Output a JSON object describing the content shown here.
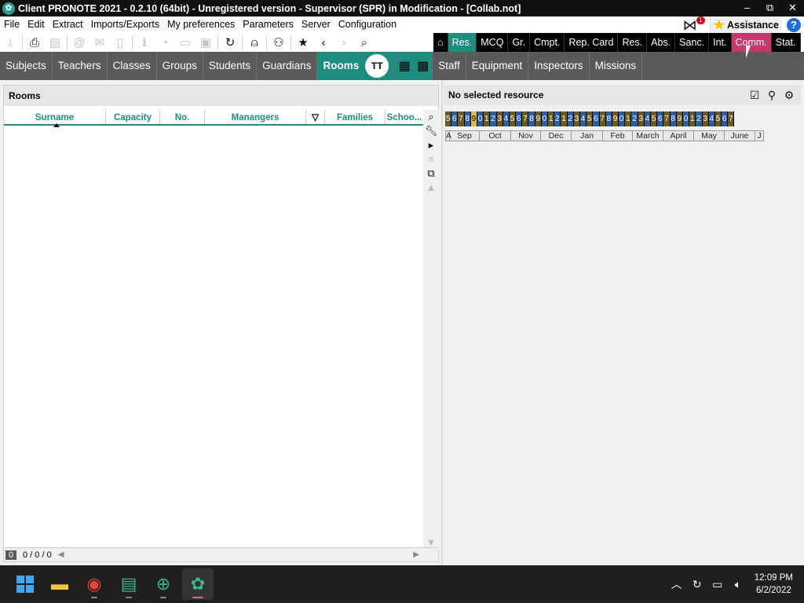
{
  "window": {
    "title": "Client PRONOTE 2021 - 0.2.10 (64bit) - Unregistered version  - Supervisor (SPR) in Modification - [Collab.not]",
    "buttons": [
      "–",
      "⧉",
      "✕"
    ]
  },
  "menu": {
    "items": [
      "File",
      "Edit",
      "Extract",
      "Imports/Exports",
      "My preferences",
      "Parameters",
      "Server",
      "Configuration"
    ],
    "notification_count": "1",
    "assistance_label": "Assistance",
    "help_label": "?"
  },
  "module_tabs": [
    "Res.",
    "MCQ",
    "Gr.",
    "Cmpt.",
    "Rep. Card",
    "Res.",
    "Abs.",
    "Sanc.",
    "Int.",
    "Comm.",
    "Stat."
  ],
  "section_tabs": [
    "Subjects",
    "Teachers",
    "Classes",
    "Groups",
    "Students",
    "Guardians",
    "Rooms",
    "Staff",
    "Equipment",
    "Inspectors",
    "Missions"
  ],
  "rooms_icon_label": "TT",
  "left_panel": {
    "title": "Rooms",
    "columns": [
      "Surname",
      "Capacity",
      "No.",
      "Manangers",
      "Families",
      "Schoo..."
    ],
    "footer_count": "0",
    "footer_pager": "0 / 0 / 0"
  },
  "right_panel": {
    "title": "No selected resource",
    "weeks": [
      "5",
      "6",
      "7",
      "8",
      "9",
      "0",
      "1",
      "2",
      "3",
      "4",
      "5",
      "6",
      "7",
      "8",
      "9",
      "0",
      "1",
      "2",
      "1",
      "2",
      "3",
      "4",
      "5",
      "6",
      "7",
      "8",
      "9",
      "0",
      "1",
      "2",
      "3",
      "4",
      "5",
      "6",
      "7",
      "8",
      "9",
      "0",
      "1",
      "2",
      "3",
      "4",
      "5",
      "6",
      "7"
    ],
    "months": [
      "A",
      "Sep",
      "Oct",
      "Nov",
      "Dec",
      "Jan",
      "Feb",
      "March",
      "April",
      "May",
      "June",
      "J"
    ]
  },
  "taskbar": {
    "time": "12:09 PM",
    "date": "6/2/2022"
  },
  "colors": {
    "accent": "#1d8d80",
    "comm_tab": "#c8386d",
    "week_brown": "#6b5a1f",
    "week_blue": "#2c5ea8",
    "week_highlight": "#e2b84c"
  }
}
